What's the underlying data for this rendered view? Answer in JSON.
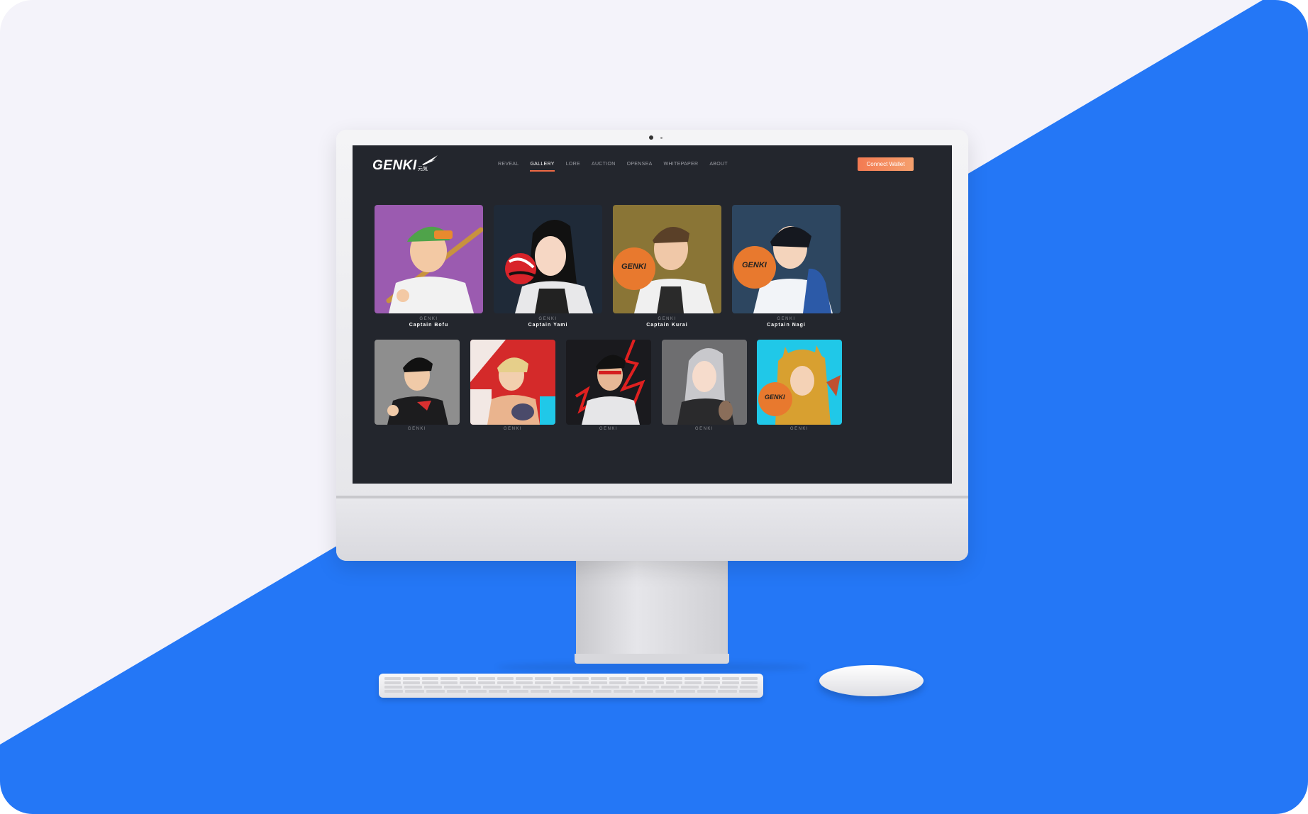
{
  "site": {
    "logo_text": "GENKI",
    "logo_sub": "元気",
    "nav": [
      {
        "label": "REVEAL",
        "active": false
      },
      {
        "label": "GALLERY",
        "active": true
      },
      {
        "label": "LORE",
        "active": false
      },
      {
        "label": "AUCTION",
        "active": false
      },
      {
        "label": "OPENSEA",
        "active": false
      },
      {
        "label": "WHITEPAPER",
        "active": false
      },
      {
        "label": "ABOUT",
        "active": false
      }
    ],
    "connect_wallet": "Connect Wallet",
    "accent_color": "#f06a45"
  },
  "gallery": {
    "row1": [
      {
        "brand": "GENKI",
        "name": "Captain Bofu",
        "bg": "#9b5bb0"
      },
      {
        "brand": "GENKI",
        "name": "Captain Yami",
        "bg": "#1f2a38"
      },
      {
        "brand": "GENKI",
        "name": "Captain Kurai",
        "bg": "#8a7536"
      },
      {
        "brand": "GENKI",
        "name": "Captain Nagi",
        "bg": "#2d4660"
      }
    ],
    "row2": [
      {
        "brand": "GENKI",
        "bg": "#8e8e8e"
      },
      {
        "brand": "GENKI",
        "bg": "#d42a2a"
      },
      {
        "brand": "GENKI",
        "bg": "#1a1a1e"
      },
      {
        "brand": "GENKI",
        "bg": "#6e6e70"
      },
      {
        "brand": "GENKI",
        "bg": "#20c8e8"
      }
    ]
  },
  "background": {
    "top_color": "#f4f3fa",
    "blue_color": "#2477f6"
  }
}
